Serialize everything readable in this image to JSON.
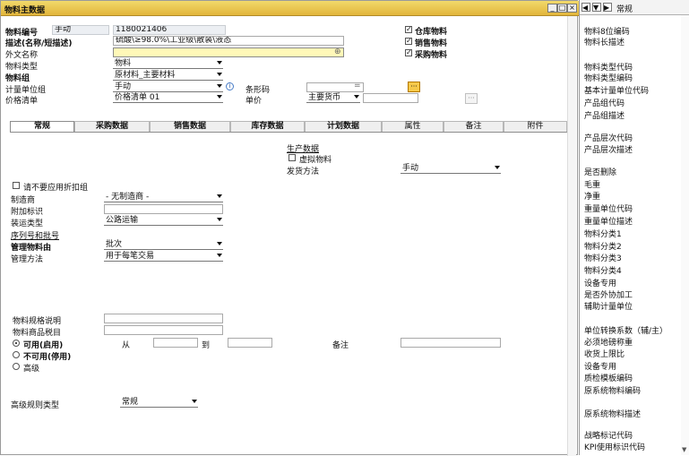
{
  "window": {
    "title": "物料主数据"
  },
  "header": {
    "item_code_label": "物料编号",
    "numbering_mode": "手动",
    "item_code_value": "1180021406",
    "description_label": "描述(名称/短描述)",
    "description_value": "硫酸\\≥98.0%\\工业级\\散装\\液态",
    "foreign_name_label": "外文名称",
    "foreign_name_value": "",
    "item_type_label": "物料类型",
    "item_type_value": "物料",
    "item_group_label": "物料组",
    "item_group_value": "原材料_主要材料",
    "uom_group_label": "计量单位组",
    "uom_group_value": "手动",
    "price_list_label": "价格清单",
    "price_list_value": "价格清单 01",
    "barcode_label": "条形码",
    "barcode_value": "",
    "unit_price_label": "单价",
    "currency_value": "主要货币",
    "unit_price_value": "",
    "inventory_item": "仓库物料",
    "sales_item": "销售物料",
    "purchase_item": "采购物料"
  },
  "tabs": [
    "常规",
    "采购数据",
    "销售数据",
    "库存数据",
    "计划数据",
    "属性",
    "备注",
    "附件"
  ],
  "general": {
    "production_data": "生产数据",
    "phantom_item": "虚拟物料",
    "issue_method_label": "发货方法",
    "issue_method_value": "手动",
    "no_discount": "请不要应用折扣组",
    "manufacturer_label": "制造商",
    "manufacturer_value": "- 无制造商 -",
    "additional_id_label": "附加标识",
    "shipping_type_label": "装运类型",
    "shipping_type_value": "公路运输",
    "serial_batch_label": "序列号和批号",
    "manage_by_label": "管理物料由",
    "manage_by_value": "批次",
    "manage_method_label": "管理方法",
    "manage_method_value": "用于每笔交易",
    "spec_label": "物料规格说明",
    "tax_label": "物料商品税目",
    "active_label": "可用(启用)",
    "inactive_label": "不可用(停用)",
    "advanced_label": "高级",
    "from_label": "从",
    "to_label": "到",
    "remarks_label": "备注",
    "adv_rule_label": "高级规则类型",
    "adv_rule_value": "常规"
  },
  "side_panel": {
    "select_value": "常规",
    "items": [
      "物料8位编码",
      "物料长描述",
      "物料类型代码",
      "物料类型编码",
      "基本计量单位代码",
      "产品组代码",
      "产品组描述",
      "产品层次代码",
      "产品层次描述",
      "是否删除",
      "毛重",
      "净重",
      "重量单位代码",
      "重量单位描述",
      "物料分类1",
      "物料分类2",
      "物料分类3",
      "物料分类4",
      "设备专用",
      "是否外协加工",
      "辅助计量单位",
      "单位转换系数（辅/主）",
      "必须地磅称重",
      "收货上限比",
      "设备专用",
      "质检模板编码",
      "原系统物料编码",
      "原系统物料描述",
      "战略标记代码",
      "KPI使用标识代码"
    ]
  }
}
